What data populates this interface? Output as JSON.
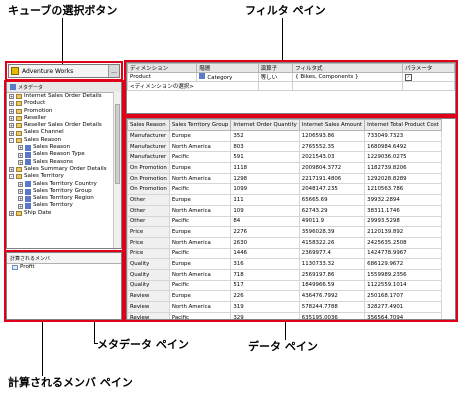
{
  "callouts": {
    "cube_button": "キューブの選択ボタン",
    "filter_pane": "フィルタ ペイン",
    "metadata_pane": "メタデータ ペイン",
    "data_pane": "データ ペイン",
    "calc_members_pane": "計算されるメンバ ペイン"
  },
  "cube_selector": {
    "value": "Adventure Works",
    "dropdown": "..."
  },
  "metadata": {
    "header": "メタデータ",
    "items": [
      {
        "label": "Internet Sales Order Details",
        "indent": 0,
        "type": "folder",
        "expand": "+"
      },
      {
        "label": "Product",
        "indent": 0,
        "type": "folder",
        "expand": "+"
      },
      {
        "label": "Promotion",
        "indent": 0,
        "type": "folder",
        "expand": "+"
      },
      {
        "label": "Reseller",
        "indent": 0,
        "type": "folder",
        "expand": "+"
      },
      {
        "label": "Reseller Sales Order Details",
        "indent": 0,
        "type": "folder",
        "expand": "+"
      },
      {
        "label": "Sales Channel",
        "indent": 0,
        "type": "folder",
        "expand": "+"
      },
      {
        "label": "Sales Reason",
        "indent": 0,
        "type": "folder",
        "expand": "-"
      },
      {
        "label": "Sales Reason",
        "indent": 1,
        "type": "hier",
        "expand": "+"
      },
      {
        "label": "Sales Reason Type",
        "indent": 1,
        "type": "hier",
        "expand": "+"
      },
      {
        "label": "Sales Reasons",
        "indent": 1,
        "type": "hier",
        "expand": "+"
      },
      {
        "label": "Sales Summary Order Details",
        "indent": 0,
        "type": "folder",
        "expand": "+"
      },
      {
        "label": "Sales Territory",
        "indent": 0,
        "type": "folder",
        "expand": "-"
      },
      {
        "label": "Sales Territory Country",
        "indent": 1,
        "type": "hier",
        "expand": "+"
      },
      {
        "label": "Sales Territory Group",
        "indent": 1,
        "type": "hier",
        "expand": "+"
      },
      {
        "label": "Sales Territory Region",
        "indent": 1,
        "type": "hier",
        "expand": "+"
      },
      {
        "label": "Sales Territory",
        "indent": 1,
        "type": "hier",
        "expand": "+"
      },
      {
        "label": "Ship Date",
        "indent": 0,
        "type": "folder",
        "expand": "+"
      }
    ]
  },
  "calc_members": {
    "header": "計算されるメンバ",
    "items": [
      "Profit"
    ]
  },
  "filter": {
    "columns": [
      "ディメンション",
      "階層",
      "演算子",
      "フィルタ式",
      "パラメータ"
    ],
    "row": {
      "dimension": "Product",
      "hierarchy": "Category",
      "operator": "等しい",
      "expression": "{ Bikes, Components }",
      "parameter": "✓"
    },
    "placeholder": "<ディメンションの選択>"
  },
  "data": {
    "columns": [
      "Sales Reason",
      "Sales Territory Group",
      "Internet Order Quantity",
      "Internet Sales Amount",
      "Internet Total Product Cost"
    ],
    "rows": [
      [
        "Manufacturer",
        "Europe",
        "352",
        "1206593.86",
        "733049.7323"
      ],
      [
        "Manufacturer",
        "North America",
        "803",
        "2765552.35",
        "1680984.6492"
      ],
      [
        "Manufacturer",
        "Pacific",
        "591",
        "2021543.03",
        "1229036.0275"
      ],
      [
        "On Promotion",
        "Europe",
        "1118",
        "2009804.3772",
        "1182739.8206"
      ],
      [
        "On Promotion",
        "North America",
        "1298",
        "2217191.4806",
        "1292028.8289"
      ],
      [
        "On Promotion",
        "Pacific",
        "1099",
        "2048147.235",
        "1210563.786"
      ],
      [
        "Other",
        "Europe",
        "111",
        "65665.69",
        "39932.2894"
      ],
      [
        "Other",
        "North America",
        "109",
        "62743.29",
        "38311.1746"
      ],
      [
        "Other",
        "Pacific",
        "84",
        "49011.9",
        "29993.5298"
      ],
      [
        "Price",
        "Europe",
        "2276",
        "3596028.39",
        "2120139.892"
      ],
      [
        "Price",
        "North America",
        "2630",
        "4158322.26",
        "2425635.2508"
      ],
      [
        "Price",
        "Pacific",
        "1446",
        "2369977.4",
        "1424778.9967"
      ],
      [
        "Quality",
        "Europe",
        "316",
        "1130733.32",
        "686129.9672"
      ],
      [
        "Quality",
        "North America",
        "718",
        "2569197.86",
        "1559989.2356"
      ],
      [
        "Quality",
        "Pacific",
        "517",
        "1849966.59",
        "1122559.1014"
      ],
      [
        "Review",
        "Europe",
        "226",
        "436476.7992",
        "250168.1707"
      ],
      [
        "Review",
        "North America",
        "319",
        "578244.7788",
        "328277.4901"
      ],
      [
        "Review",
        "Pacific",
        "329",
        "635195.0036",
        "356564.7094"
      ]
    ]
  },
  "colors": {
    "highlight": "#e0001a"
  }
}
